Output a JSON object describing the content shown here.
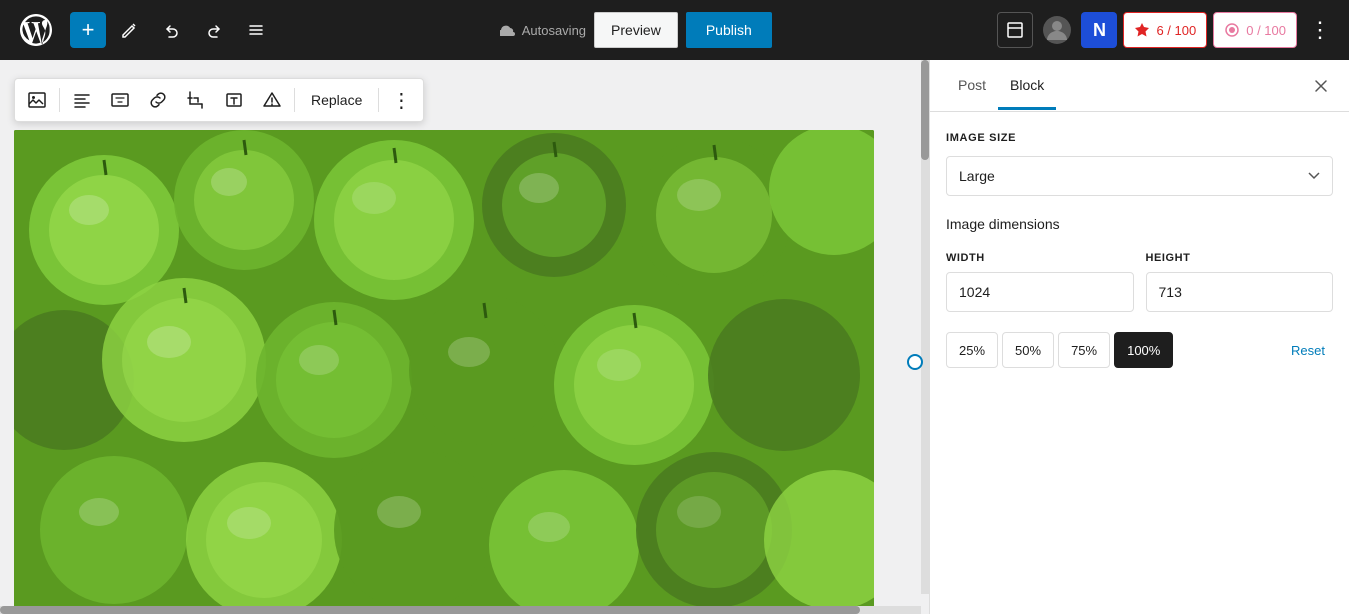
{
  "toolbar": {
    "add_label": "+",
    "preview_label": "Preview",
    "publish_label": "Publish",
    "autosave_label": "Autosaving",
    "more_label": "⋮",
    "score1_label": "6 / 100",
    "score2_label": "0 / 100"
  },
  "image_toolbar": {
    "replace_label": "Replace",
    "more_label": "⋮"
  },
  "sidebar": {
    "tab_post": "Post",
    "tab_block": "Block",
    "section_image_size": "IMAGE SIZE",
    "size_value": "Large",
    "section_dimensions": "Image dimensions",
    "width_label": "WIDTH",
    "height_label": "HEIGHT",
    "width_value": "1024",
    "height_value": "713",
    "pct_25": "25%",
    "pct_50": "50%",
    "pct_75": "75%",
    "pct_100": "100%",
    "reset_label": "Reset"
  }
}
